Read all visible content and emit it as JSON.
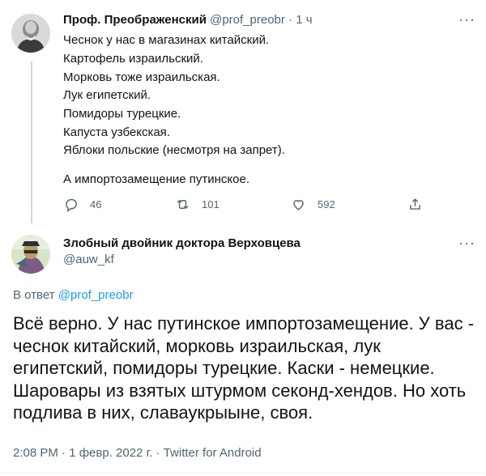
{
  "parent_tweet": {
    "display_name": "Проф. Преображенский",
    "handle": "@prof_preobr",
    "separator": "·",
    "time": "1 ч",
    "lines": [
      "Чеснок у нас в магазинах китайский.",
      "Картофель израильский.",
      "Морковь тоже израильская.",
      "Лук египетский.",
      "Помидоры турецкие.",
      "Капуста узбекская.",
      "Яблоки польские (несмотря на запрет).",
      "",
      "А импортозамещение путинское."
    ],
    "reply_count": "46",
    "retweet_count": "101",
    "like_count": "592",
    "icons": [
      "reply-icon",
      "retweet-icon",
      "like-icon",
      "share-icon",
      "more-icon"
    ]
  },
  "main_tweet": {
    "display_name": "Злобный двойник доктора Верховцева",
    "handle": "@auw_kf",
    "reply_prefix": "В ответ",
    "reply_to": "@prof_preobr",
    "text": "Всё верно. У нас путинское импортозамещение. У вас - чеснок китайский, морковь израильская, лук египетский, помидоры турецкие. Каски - немецкие. Шаровары из взятых штурмом секонд-хендов. Но хоть подлива в них, славаукрыыне, своя.",
    "meta": "2:08 PM · 1 февр. 2022 г. · Twitter for Android"
  },
  "colors": {
    "accent": "#1d9bf0",
    "muted": "#536471",
    "text": "#0f1419",
    "divider": "#eff3f4"
  }
}
